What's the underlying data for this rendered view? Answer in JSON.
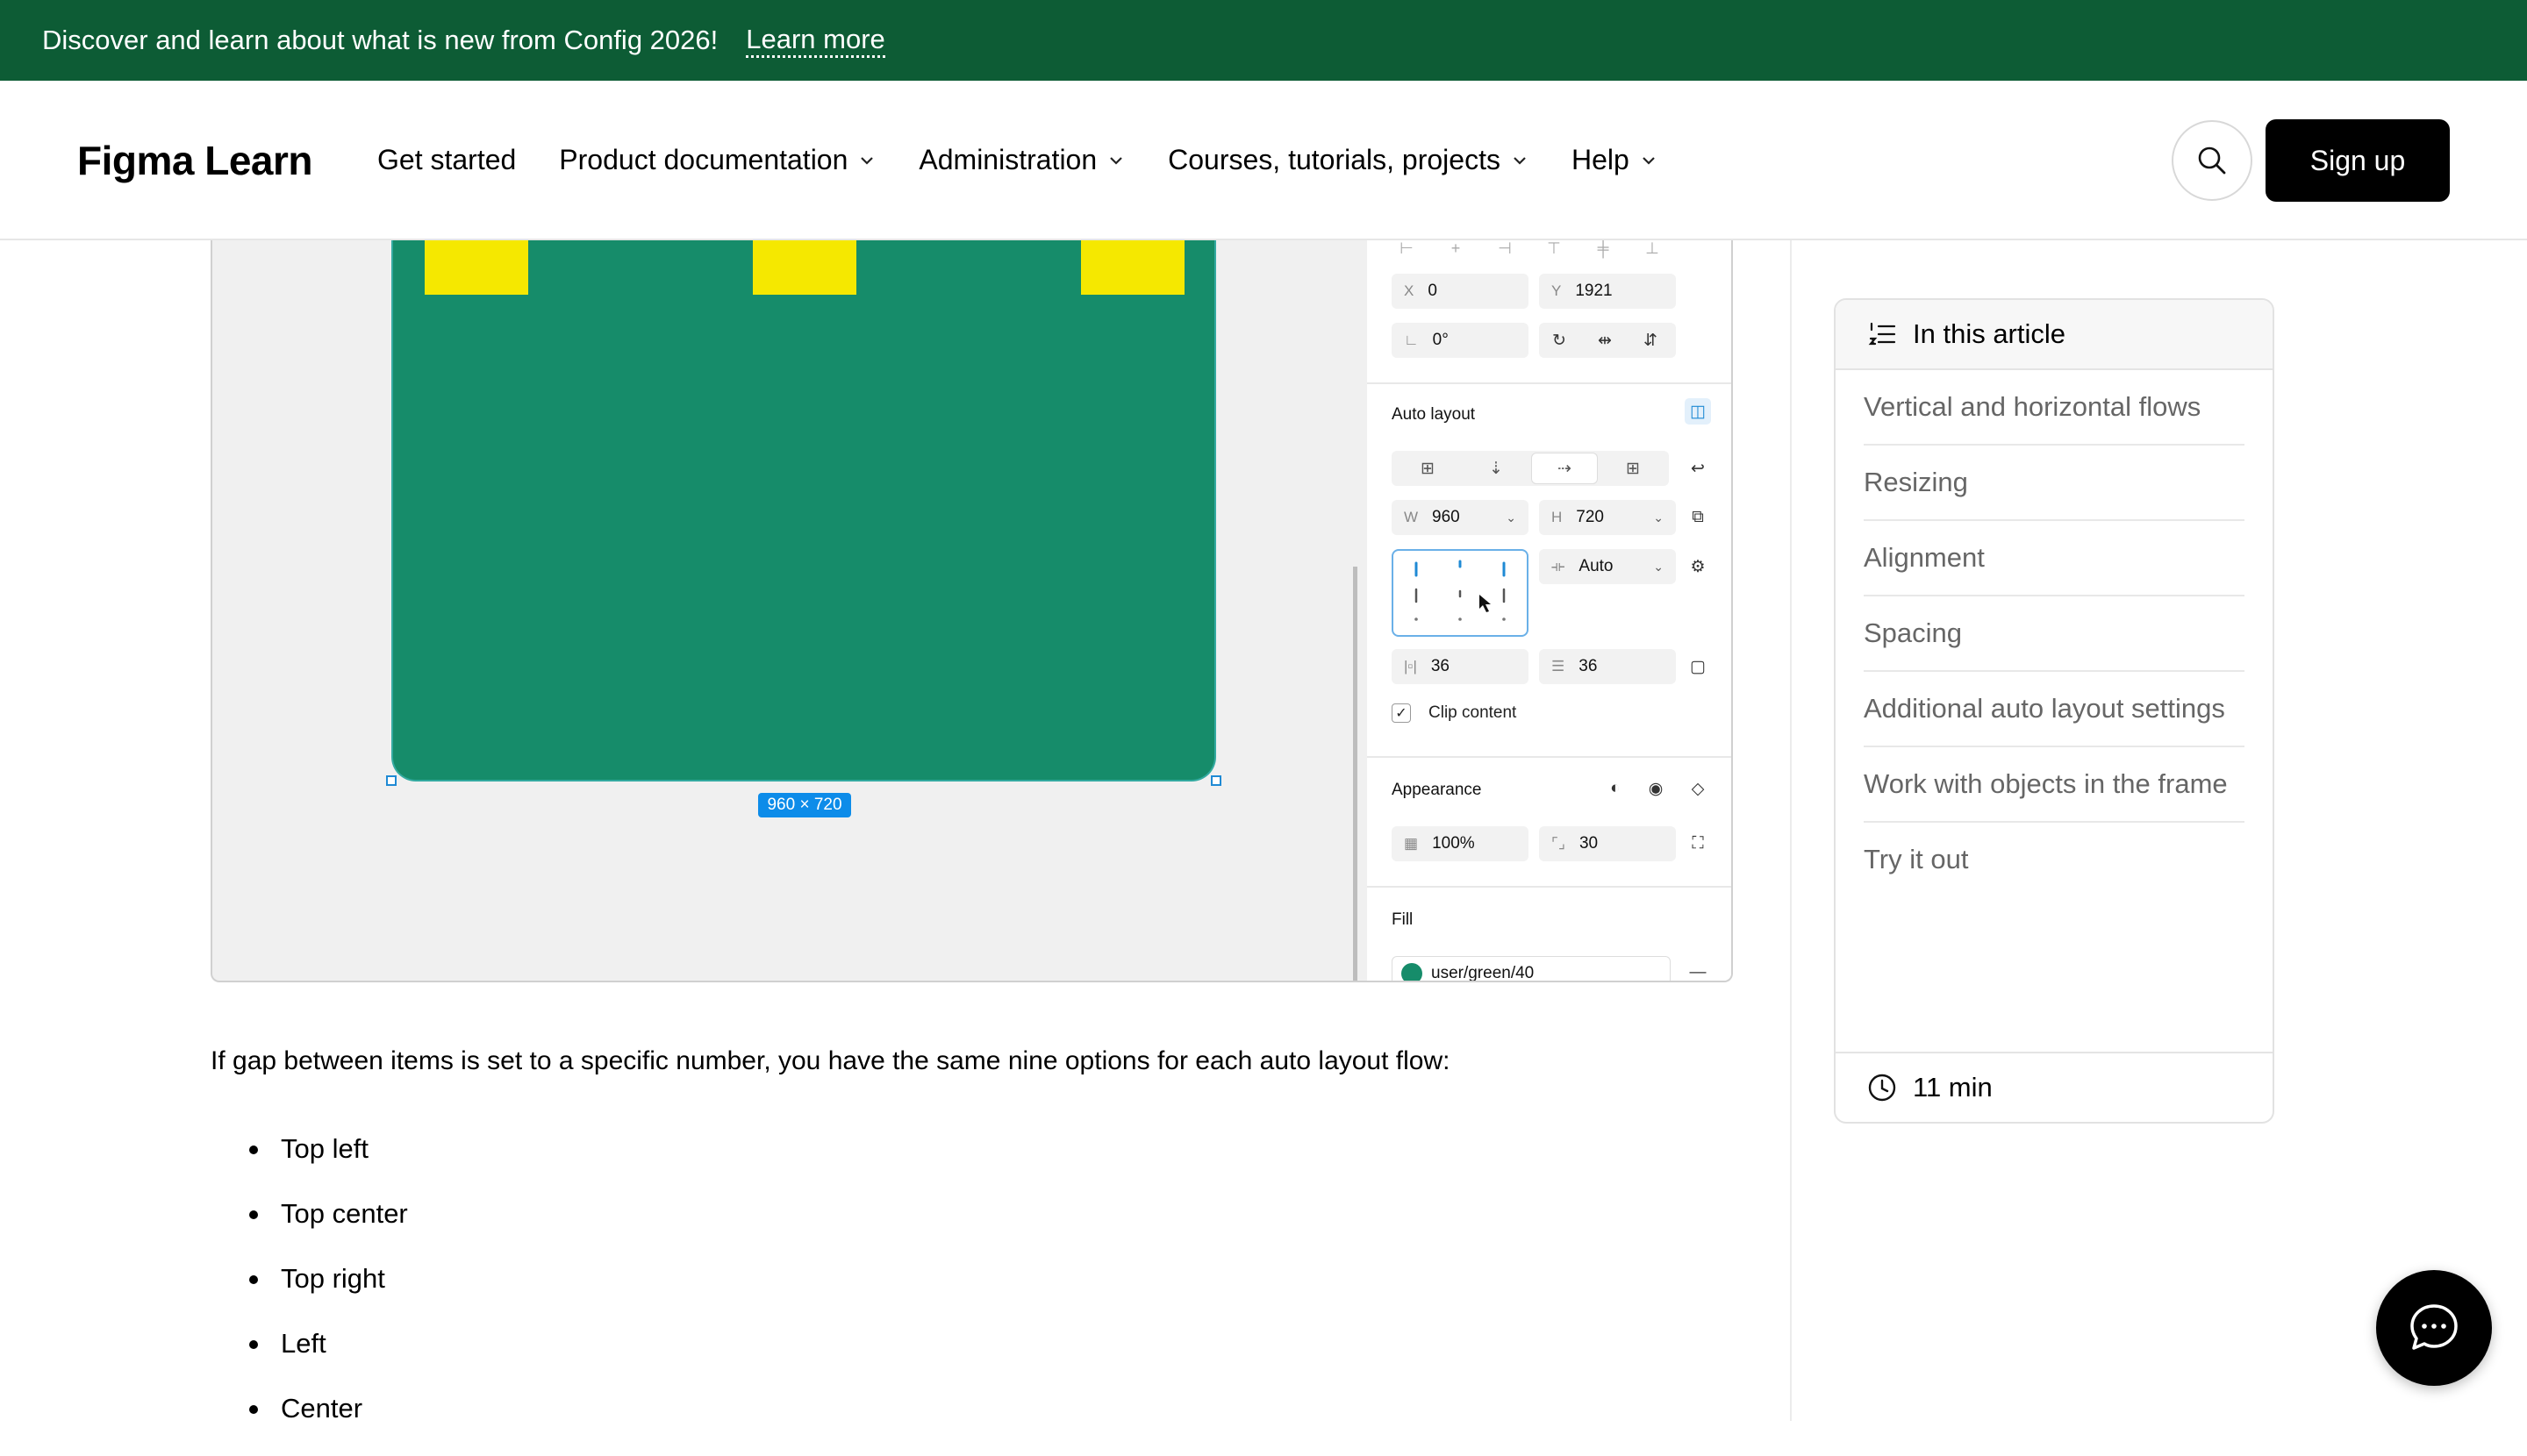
{
  "banner": {
    "text": "Discover and learn about what is new from Config 2026!",
    "link": "Learn more"
  },
  "header": {
    "logo": "Figma Learn",
    "nav": [
      {
        "label": "Get started",
        "dropdown": false
      },
      {
        "label": "Product documentation",
        "dropdown": true
      },
      {
        "label": "Administration",
        "dropdown": true
      },
      {
        "label": "Courses, tutorials, projects",
        "dropdown": true
      },
      {
        "label": "Help",
        "dropdown": true
      }
    ],
    "signup": "Sign up",
    "search_icon": "search-icon"
  },
  "figure": {
    "dimension_label": "960 × 720",
    "colors": {
      "frame": "#168c6a",
      "items": "#f5e800",
      "selection": "#0d8ce9"
    },
    "panel": {
      "x_prefix": "X",
      "x_value": "0",
      "y_prefix": "Y",
      "y_value": "1921",
      "rotation": "0°",
      "auto_layout_title": "Auto layout",
      "w_prefix": "W",
      "w_value": "960",
      "h_prefix": "H",
      "h_value": "720",
      "gap_value": "Auto",
      "padding_h": "36",
      "padding_v": "36",
      "clip_content": "Clip content",
      "appearance_title": "Appearance",
      "opacity": "100%",
      "radius": "30",
      "fill_title": "Fill",
      "fill_name": "user/green/40"
    }
  },
  "article": {
    "paragraph": "If gap between items is set to a specific number, you have the same nine options for each auto layout flow:",
    "list": [
      "Top left",
      "Top center",
      "Top right",
      "Left",
      "Center"
    ]
  },
  "toc": {
    "title": "In this article",
    "items": [
      "Vertical and horizontal flows",
      "Resizing",
      "Alignment",
      "Spacing",
      "Additional auto layout settings",
      "Work with objects in the frame",
      "Try it out"
    ],
    "read_time": "11 min"
  }
}
